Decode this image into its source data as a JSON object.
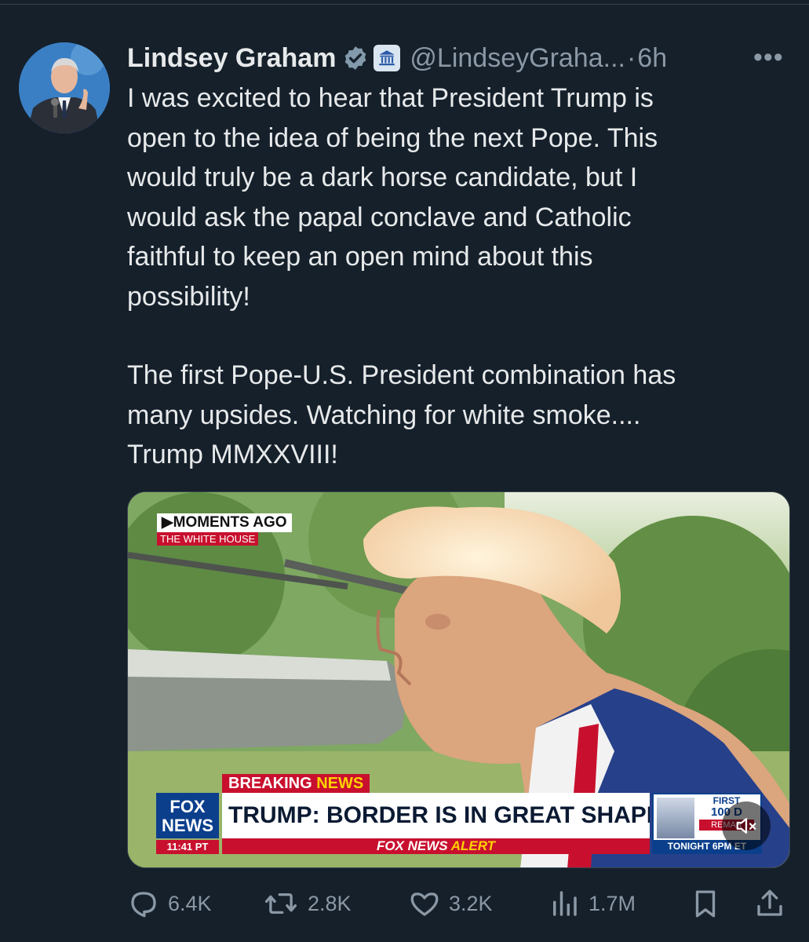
{
  "tweet": {
    "display_name": "Lindsey Graham",
    "handle": "@LindseyGraha...",
    "separator": "·",
    "time": "6h",
    "more_label": "•••",
    "text_lines_p1": [
      "I was excited to hear that President Trump is",
      "open to the idea of being the next Pope. This",
      "would truly be a dark horse candidate, but I",
      "would ask the papal conclave and Catholic",
      "faithful to keep an open mind about this",
      "possibility!"
    ],
    "text_lines_p2": [
      "The first Pope-U.S. President combination has",
      "many upsides. Watching for white smoke....",
      "Trump MMXXVIII!"
    ]
  },
  "media": {
    "moments_ago": "▶MOMENTS AGO",
    "location": "THE WHITE HOUSE",
    "breaking": "BREAKING",
    "news": "NEWS",
    "headline": "TRUMP: BORDER IS IN GREAT SHAPE",
    "alert_prefix": "FOX NEWS",
    "alert_word": "ALERT",
    "fox_logo_line1": "FOX",
    "fox_logo_line2": "NEWS",
    "fox_time": "11:41 PT",
    "promo_first": "FIRST",
    "promo_100": "100 D",
    "promo_remarks": "REMAR",
    "promo_tonight": "TONIGHT 6PM ET"
  },
  "actions": {
    "replies": "6.4K",
    "reposts": "2.8K",
    "likes": "3.2K",
    "views": "1.7M"
  },
  "colors": {
    "background": "#15202b",
    "text": "#e7e9ea",
    "muted": "#8b98a5",
    "verified": "#829aab"
  }
}
